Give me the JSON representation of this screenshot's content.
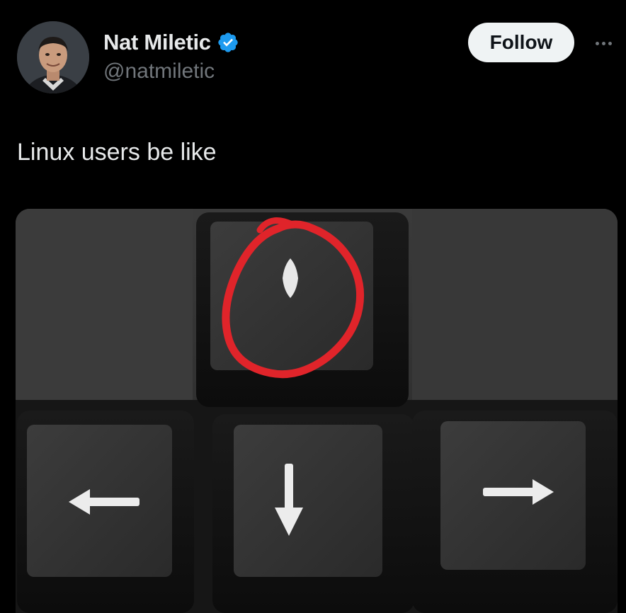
{
  "author": {
    "display_name": "Nat Miletic",
    "handle": "@natmiletic",
    "verified": true,
    "verified_icon": "verified-badge-icon",
    "verified_color": "#1d9bf0"
  },
  "actions": {
    "follow_label": "Follow",
    "more_icon": "more-horizontal-icon"
  },
  "tweet": {
    "text": "Linux users be like"
  },
  "media": {
    "description_icons": [
      "arrow-left-icon",
      "arrow-down-icon",
      "arrow-right-icon",
      "diamond-icon"
    ],
    "highlight_color": "#e0242a"
  },
  "theme": {
    "background": "#000000",
    "text_primary": "#e7e9ea",
    "text_secondary": "#71767b",
    "button_bg": "#eff3f4"
  }
}
